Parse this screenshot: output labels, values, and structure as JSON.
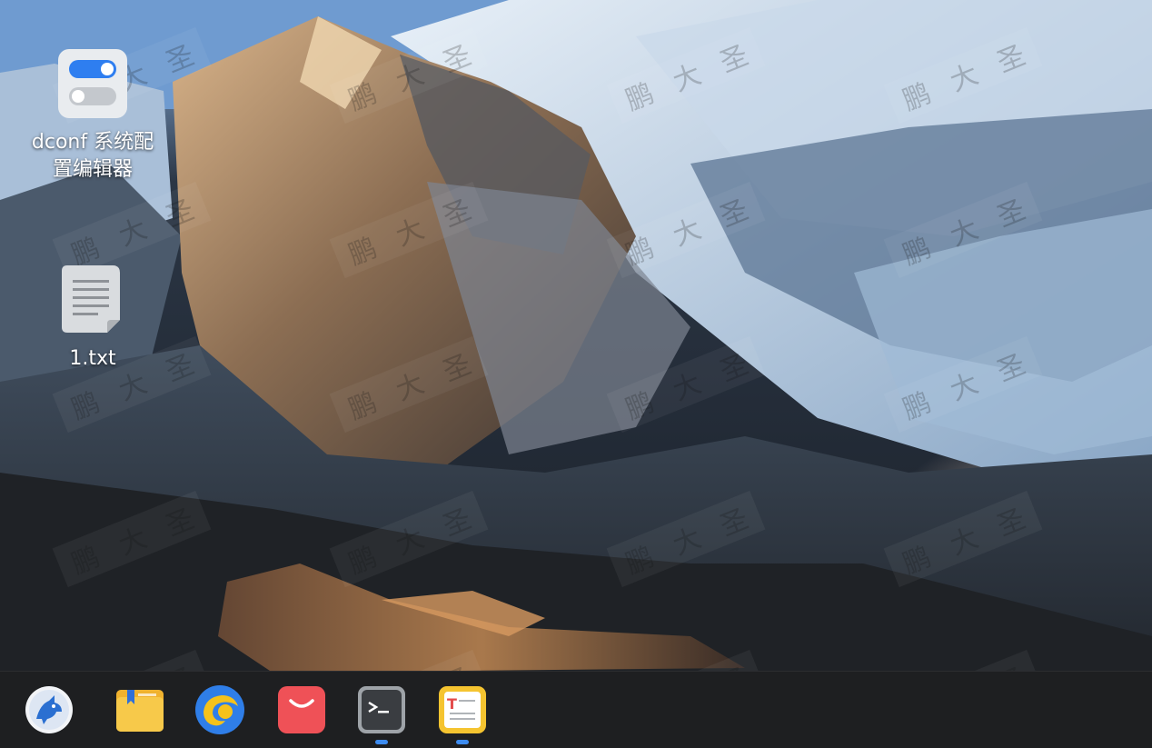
{
  "desktop": {
    "icons": [
      {
        "label": "dconf 系统配置编辑器",
        "icon": "dconf-editor-icon"
      },
      {
        "label": "1.txt",
        "icon": "text-file-icon"
      }
    ],
    "watermark": {
      "chars": [
        "鹏",
        "大",
        "圣"
      ]
    }
  },
  "dock": {
    "items": [
      {
        "icon": "start-menu-icon",
        "running": false
      },
      {
        "icon": "file-manager-icon",
        "running": false
      },
      {
        "icon": "browser-icon",
        "running": false
      },
      {
        "icon": "app-store-icon",
        "running": false
      },
      {
        "icon": "terminal-icon",
        "running": true
      },
      {
        "icon": "text-editor-icon",
        "running": true
      }
    ]
  },
  "colors": {
    "dock_bg": "#1e1f21",
    "running_indicator": "#3d8cf0",
    "label_text": "#ffffff"
  }
}
